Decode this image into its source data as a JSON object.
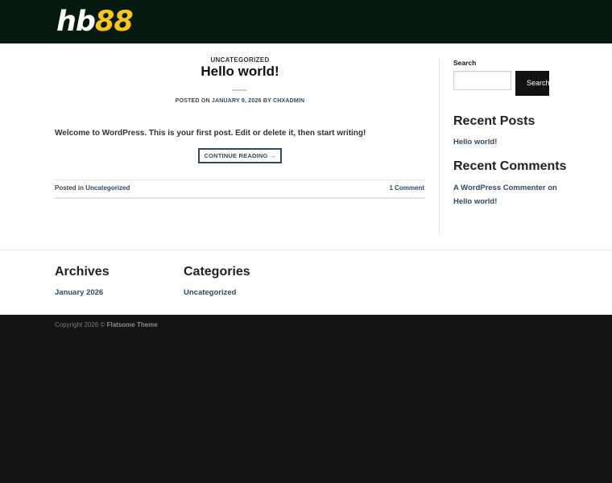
{
  "header": {
    "logo_part1": "hb",
    "logo_part2": "88"
  },
  "post": {
    "category_tag": "UNCATEGORIZED",
    "title": "Hello world!",
    "meta_prefix": "POSTED ON",
    "meta_date": "JANUARY 9, 2026",
    "meta_by": "BY",
    "meta_author": "CHXADMIN",
    "excerpt": "Welcome to WordPress. This is your first post. Edit or delete it, then start writing!",
    "continue_label": "CONTINUE READING →",
    "posted_in_label": "Posted in",
    "posted_in_category": "Uncategorized",
    "comments_label": "1 Comment"
  },
  "sidebar": {
    "search_label": "Search",
    "search_placeholder": "",
    "search_button_label": "Search",
    "recent_posts_title": "Recent Posts",
    "recent_posts": [
      "Hello world!"
    ],
    "recent_comments_title": "Recent Comments",
    "comment_author": "A WordPress Commenter",
    "comment_on": "on",
    "comment_post": "Hello world!"
  },
  "footer_widgets": {
    "archives_title": "Archives",
    "archives": [
      "January 2026"
    ],
    "categories_title": "Categories",
    "categories": [
      "Uncategorized"
    ]
  },
  "bottom_bar": {
    "copyright_text": "Copyright 2026 ©",
    "theme_name": "Flatsome Theme"
  },
  "colors": {
    "header_bg": "#05190f",
    "logo_accent": "#f7c51c",
    "link": "#334862",
    "footer_bg": "#141414"
  }
}
